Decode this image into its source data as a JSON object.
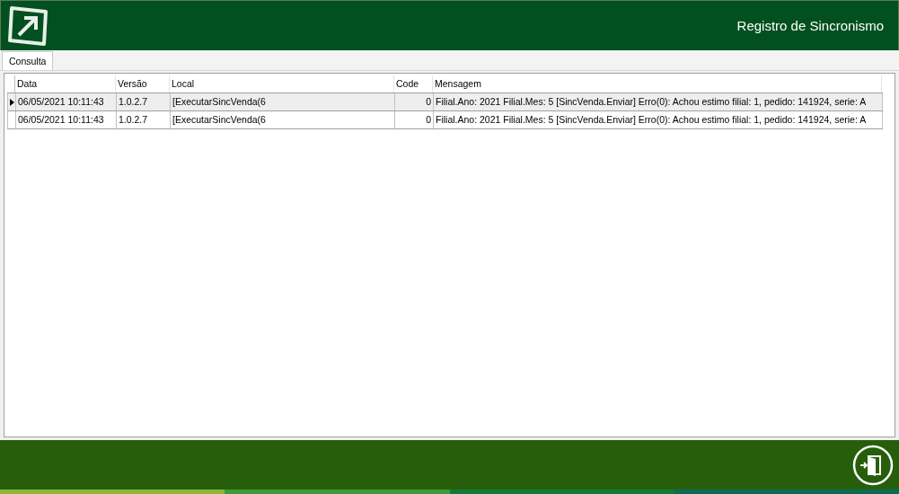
{
  "window": {
    "title": "Registro de Sincronismo"
  },
  "tabs": [
    {
      "label": "Consulta",
      "selected": true
    }
  ],
  "table": {
    "columns": [
      "Data",
      "Versão",
      "Local",
      "Code",
      "Mensagem"
    ],
    "rows": [
      {
        "selected": true,
        "cells": [
          "06/05/2021 10:11:43",
          "1.0.2.7",
          "[ExecutarSincVenda(6",
          "0",
          "Filial.Ano: 2021 Filial.Mes: 5 [SincVenda.Enviar] Erro(0): Achou estimo filial: 1, pedido: 141924, serie: A"
        ]
      },
      {
        "selected": false,
        "cells": [
          "06/05/2021 10:11:43",
          "1.0.2.7",
          "[ExecutarSincVenda(6",
          "0",
          "Filial.Ano: 2021 Filial.Mes: 5 [SincVenda.Enviar] Erro(0): Achou estimo filial: 1, pedido: 141924, serie: A"
        ]
      }
    ]
  }
}
